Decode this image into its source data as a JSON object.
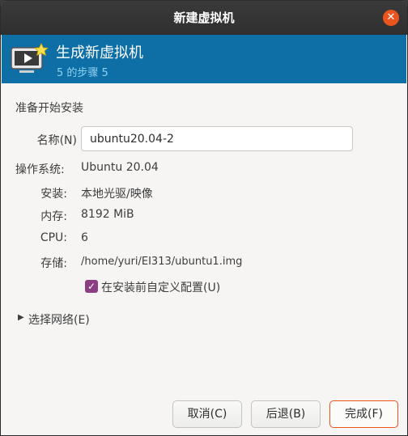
{
  "window": {
    "title": "新建虚拟机"
  },
  "banner": {
    "title": "生成新虚拟机",
    "step": "5 的步骤 5"
  },
  "section": {
    "heading": "准备开始安装"
  },
  "name_field": {
    "label": "名称(N)",
    "value": "ubuntu20.04-2"
  },
  "details": [
    {
      "label": "操作系统:",
      "value": "Ubuntu 20.04"
    },
    {
      "label": "安装:",
      "value": "本地光驱/映像"
    },
    {
      "label": "内存:",
      "value": "8192 MiB"
    },
    {
      "label": "CPU:",
      "value": "6"
    },
    {
      "label": "存储:",
      "value": "/home/yuri/EI313/ubuntu1.img"
    }
  ],
  "customize_checkbox": {
    "label": "在安装前自定义配置(U)",
    "checked": true
  },
  "network_expander": {
    "label": "选择网络(E)",
    "expanded": false
  },
  "buttons": {
    "cancel": "取消(C)",
    "back": "后退(B)",
    "finish": "完成(F)"
  },
  "colors": {
    "banner": "#0e6fa6",
    "accent": "#e9541f",
    "checkbox": "#8c3e83"
  }
}
